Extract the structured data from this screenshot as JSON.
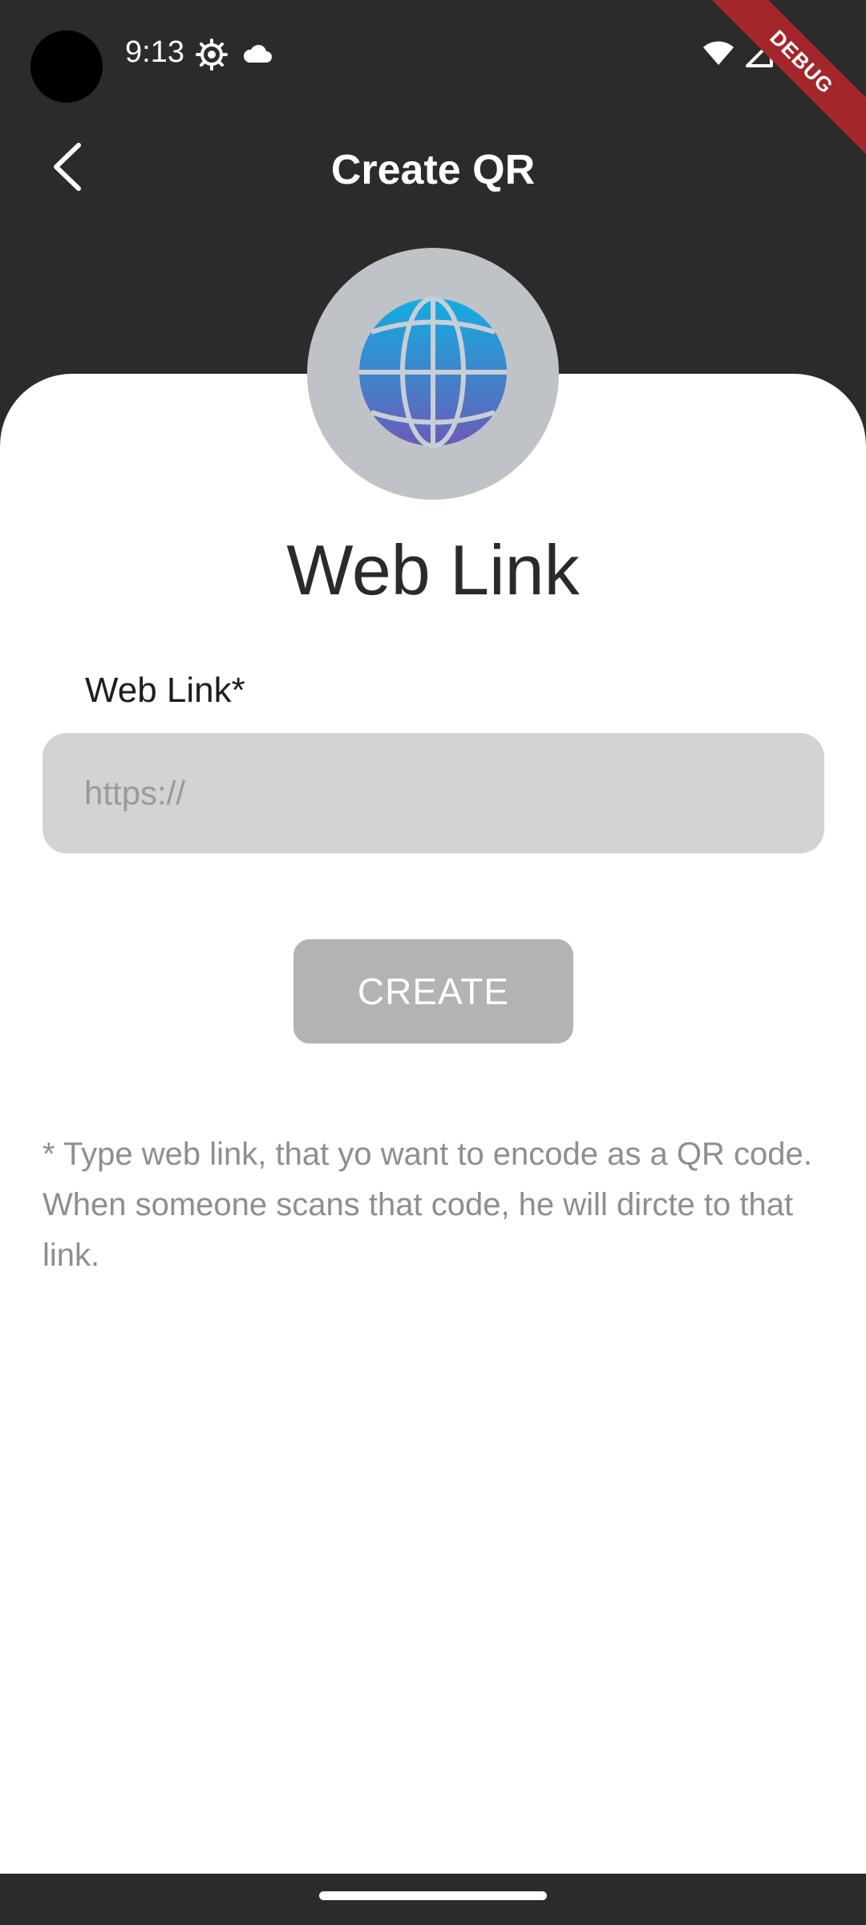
{
  "status_bar": {
    "time": "9:13",
    "icons": [
      "settings-icon",
      "cloud-icon",
      "wifi-icon",
      "signal-icon",
      "battery-icon"
    ]
  },
  "debug_banner": "DEBUG",
  "app_bar": {
    "title": "Create QR",
    "back_icon": "chevron-left-icon"
  },
  "content": {
    "icon": "globe-icon",
    "heading": "Web Link",
    "field_label": "Web Link*",
    "input_value": "",
    "input_placeholder": "https://",
    "create_label": "CREATE",
    "hint": "* Type web link, that yo want to encode as a QR code. When someone scans that code, he will dircte to that link."
  },
  "colors": {
    "background": "#2b2b2b",
    "card": "#ffffff",
    "input": "#d3d3d3",
    "button": "#b3b3b3",
    "avatar": "#bfc3c7",
    "globe_top": "#12aee0",
    "globe_bottom": "#6a5cb8",
    "debug": "#a3262b"
  }
}
